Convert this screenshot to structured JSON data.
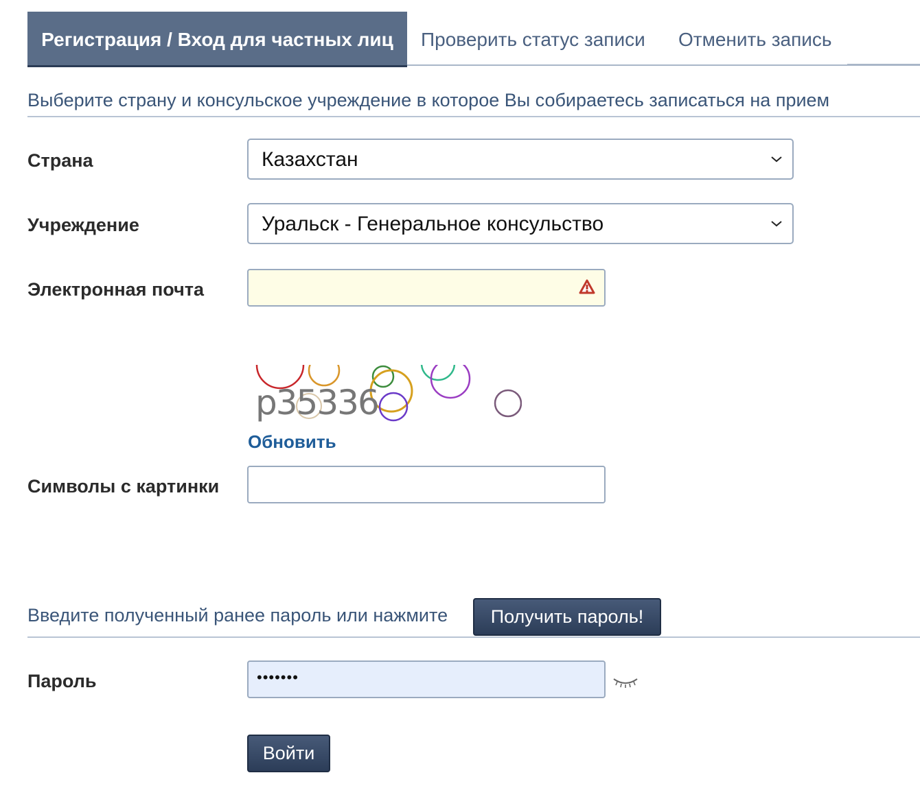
{
  "tabs": {
    "active": "Регистрация / Вход для частных лиц",
    "status": "Проверить статус записи",
    "cancel": "Отменить запись"
  },
  "section1": {
    "title": "Выберите страну и консульское учреждение в которое Вы собираетесь записаться на прием"
  },
  "form": {
    "country_label": "Страна",
    "country_value": "Казахстан",
    "institution_label": "Учреждение",
    "institution_value": "Уральск - Генеральное консульство",
    "email_label": "Электронная почта",
    "email_value": "",
    "captcha_text": "p35336",
    "refresh_label": "Обновить",
    "captcha_label": "Символы с картинки",
    "captcha_value": ""
  },
  "section2": {
    "title": "Введите полученный ранее пароль или нажмите",
    "get_password_label": "Получить пароль!"
  },
  "password": {
    "label": "Пароль",
    "masked_value": "•••••••"
  },
  "login_label": "Войти",
  "icons": {
    "select_arrow": "chevron-down-icon",
    "email_warning": "warning-icon",
    "password_toggle": "eye-closed-icon"
  },
  "colors": {
    "tab_active_bg": "#5a6d88",
    "heading_text": "#3a5578",
    "link": "#1f5d99",
    "button_bg": "#2c3d58",
    "email_bg": "#fefde6",
    "password_bg": "#e6eefc",
    "warning": "#c0392b"
  }
}
